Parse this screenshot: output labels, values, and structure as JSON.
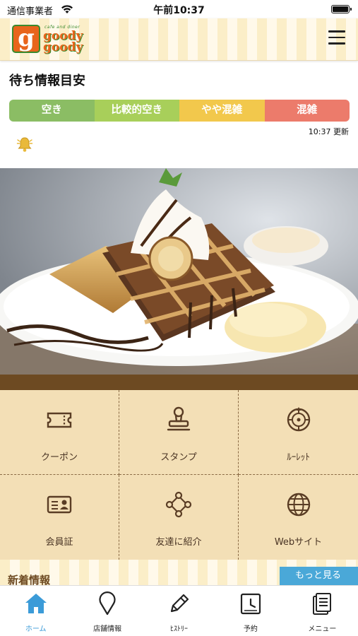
{
  "status_bar": {
    "carrier": "通信事業者",
    "time": "午前10:37"
  },
  "header": {
    "logo_tagline": "cafe and diner",
    "logo_word1": "goody",
    "logo_word2": "goody",
    "logo_letter": "g",
    "menu_icon": "hamburger-icon"
  },
  "wait_info": {
    "title": "待ち情報目安",
    "levels": [
      {
        "label": "空き",
        "color": "#8bbd64"
      },
      {
        "label": "比較的空き",
        "color": "#a8cf5a"
      },
      {
        "label": "やや混雑",
        "color": "#f2c84c"
      },
      {
        "label": "混雑",
        "color": "#ec7b6b"
      }
    ],
    "updated": "10:37 更新",
    "bell_icon": "bell-icon"
  },
  "hero": {
    "image": "waffle-dessert-photo"
  },
  "menu_grid": [
    {
      "label": "クーポン",
      "icon": "ticket-icon"
    },
    {
      "label": "スタンプ",
      "icon": "stamp-icon"
    },
    {
      "label": "ﾙｰﾚｯﾄ",
      "icon": "roulette-icon"
    },
    {
      "label": "会員証",
      "icon": "member-card-icon"
    },
    {
      "label": "友達に紹介",
      "icon": "share-icon"
    },
    {
      "label": "Webサイト",
      "icon": "globe-icon"
    }
  ],
  "news": {
    "title": "新着情報",
    "more": "もっと見る"
  },
  "tab_bar": [
    {
      "label": "ホーム",
      "icon": "home-icon",
      "active": true
    },
    {
      "label": "店舗情報",
      "icon": "location-pin-icon",
      "active": false
    },
    {
      "label": "ﾋｽﾄﾘｰ",
      "icon": "pencil-icon",
      "active": false
    },
    {
      "label": "予約",
      "icon": "clock-icon",
      "active": false
    },
    {
      "label": "メニュー",
      "icon": "menu-book-icon",
      "active": false
    }
  ],
  "colors": {
    "brand_orange": "#e8651c",
    "brand_green": "#3a8a2e",
    "grid_background": "#f3dfb6",
    "brown_band": "#6d4a22",
    "active_tab": "#3b9bd8"
  }
}
